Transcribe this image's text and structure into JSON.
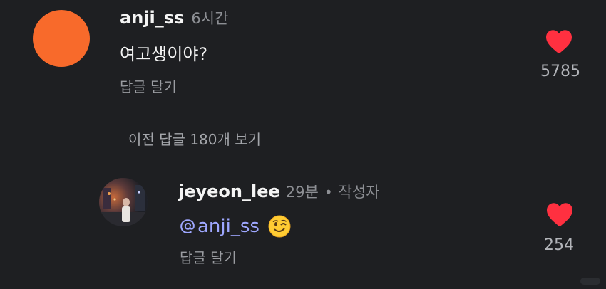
{
  "comments": [
    {
      "username": "anji_ss",
      "time": "6시간",
      "text": "여고생이야?",
      "reply_label": "답글 달기",
      "like_count": "5785",
      "avatar_color": "#f86a2b"
    }
  ],
  "view_previous_label": "이전 답글 180개 보기",
  "reply": {
    "username": "jeyeon_lee",
    "time": "29분",
    "separator": "•",
    "author_badge": "작성자",
    "mention": "anji_ss",
    "emoji": "winking-face",
    "reply_label": "답글 달기",
    "like_count": "254"
  },
  "colors": {
    "background": "#1e1f22",
    "heart": "#ff3040",
    "mention": "#9ea7ff"
  }
}
